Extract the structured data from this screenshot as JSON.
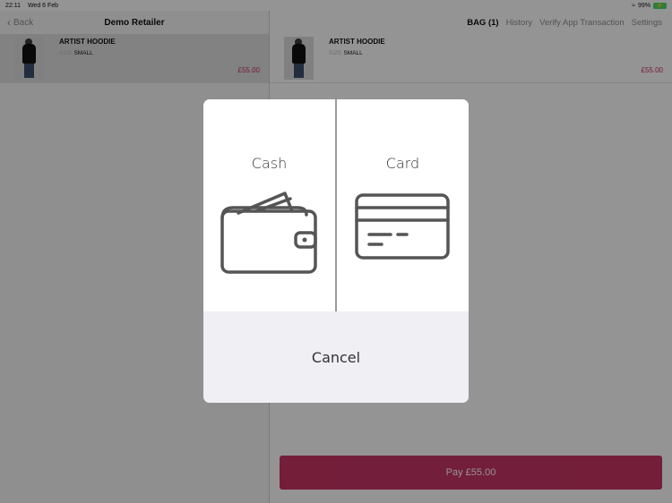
{
  "status_bar": {
    "time": "22:11",
    "date": "Wed 6 Feb",
    "battery": "99%"
  },
  "left_nav": {
    "back_label": "Back",
    "title": "Demo Retailer"
  },
  "right_nav": {
    "tabs": [
      {
        "label": "BAG (1)",
        "active": true
      },
      {
        "label": "History",
        "active": false
      },
      {
        "label": "Verify App Transaction",
        "active": false
      },
      {
        "label": "Settings",
        "active": false
      }
    ]
  },
  "product": {
    "name": "ARTIST HOODIE",
    "size_label": "SIZE",
    "size_value": "SMALL",
    "price": "£55.00"
  },
  "pay_button": {
    "label": "Pay £55.00"
  },
  "payment_modal": {
    "options": [
      {
        "label": "Cash",
        "icon": "wallet-icon"
      },
      {
        "label": "Card",
        "icon": "credit-card-icon"
      }
    ],
    "cancel_label": "Cancel"
  },
  "colors": {
    "accent": "#c52a5c",
    "price": "#c92a62",
    "battery": "#4cd964"
  }
}
